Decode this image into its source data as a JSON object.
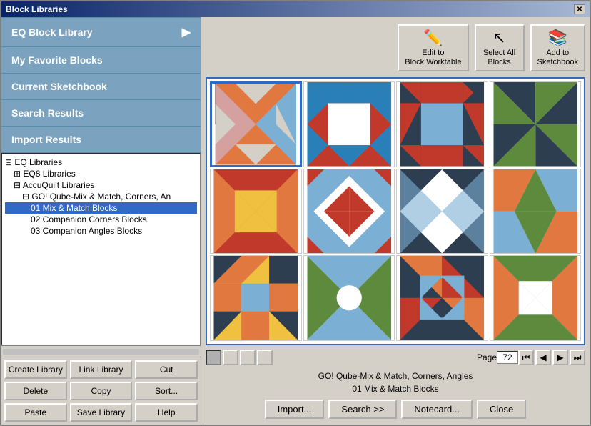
{
  "window": {
    "title": "Block Libraries",
    "close_label": "✕"
  },
  "left_nav": {
    "items": [
      {
        "label": "EQ Block Library",
        "arrow": "▶",
        "active": false
      },
      {
        "label": "My Favorite Blocks",
        "arrow": "",
        "active": false
      },
      {
        "label": "Current Sketchbook",
        "arrow": "",
        "active": false
      },
      {
        "label": "Search Results",
        "arrow": "",
        "active": false
      },
      {
        "label": "Import Results",
        "arrow": "",
        "active": false
      }
    ]
  },
  "tree": {
    "nodes": [
      {
        "label": "EQ Libraries",
        "indent": 0,
        "prefix": "⊟ "
      },
      {
        "label": "EQ8 Libraries",
        "indent": 1,
        "prefix": "⊞ "
      },
      {
        "label": "AccuQuilt Libraries",
        "indent": 1,
        "prefix": "⊟ "
      },
      {
        "label": "GO! Qube-Mix & Match, Corners, An",
        "indent": 2,
        "prefix": "⊟ "
      },
      {
        "label": "01 Mix & Match Blocks",
        "indent": 3,
        "selected": true
      },
      {
        "label": "02 Companion Corners Blocks",
        "indent": 3
      },
      {
        "label": "03 Companion Angles Blocks",
        "indent": 3
      }
    ]
  },
  "bottom_buttons": [
    {
      "label": "Create Library",
      "row": 1,
      "col": 1
    },
    {
      "label": "Link Library",
      "row": 1,
      "col": 2
    },
    {
      "label": "Cut",
      "row": 1,
      "col": 3
    },
    {
      "label": "Delete",
      "row": 2,
      "col": 1
    },
    {
      "label": "Copy",
      "row": 2,
      "col": 2
    },
    {
      "label": "Sort...",
      "row": 2,
      "col": 3
    },
    {
      "label": "Paste",
      "row": 3,
      "col": 1
    },
    {
      "label": "Save Library",
      "row": 3,
      "col": 2
    },
    {
      "label": "Help",
      "row": 3,
      "col": 3
    }
  ],
  "toolbar": {
    "buttons": [
      {
        "icon": "✏️",
        "label": "Edit to\nBlock Worktable"
      },
      {
        "icon": "🖱",
        "label": "Select All\nBlocks"
      },
      {
        "icon": "📚",
        "label": "Add to\nSketchbook"
      }
    ]
  },
  "grid": {
    "page": "72",
    "view_btns": [
      "▪",
      "▪",
      "▪",
      "▪"
    ]
  },
  "info": {
    "library": "GO! Qube-Mix & Match, Corners, Angles",
    "block": "01 Mix & Match Blocks"
  },
  "actions": [
    {
      "label": "Import..."
    },
    {
      "label": "Search  >>"
    },
    {
      "label": "Notecard..."
    },
    {
      "label": "Close"
    }
  ],
  "search": {
    "label": "Search"
  }
}
